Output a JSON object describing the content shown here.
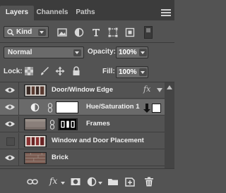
{
  "tabs": [
    {
      "label": "Layers",
      "active": true
    },
    {
      "label": "Channels",
      "active": false
    },
    {
      "label": "Paths",
      "active": false
    }
  ],
  "filter": {
    "kind_label": "Kind",
    "icons": [
      "image-filter-icon",
      "adjustment-filter-icon",
      "type-filter-icon",
      "shape-filter-icon",
      "smart-object-filter-icon"
    ]
  },
  "blend": {
    "mode": "Normal",
    "opacity_label": "Opacity:",
    "opacity_value": "100%"
  },
  "lock": {
    "label": "Lock:",
    "fill_label": "Fill:",
    "fill_value": "100%"
  },
  "layers": [
    {
      "name": "Door/Window Edge",
      "visible": true,
      "selected": false,
      "type": "pixel",
      "fx": "fx"
    },
    {
      "name": "Hue/Saturation 1",
      "visible": true,
      "selected": true,
      "type": "adjustment"
    },
    {
      "name": "Frames",
      "visible": true,
      "selected": false,
      "type": "pixel-mask"
    },
    {
      "name": "Window and Door Placement",
      "visible": false,
      "selected": false,
      "type": "pixel"
    },
    {
      "name": "Brick",
      "visible": true,
      "selected": false,
      "type": "pixel"
    }
  ],
  "bottom_icons": [
    "link-layers-icon",
    "add-style-icon",
    "add-mask-icon",
    "adjustment-layer-icon",
    "new-group-icon",
    "new-layer-icon",
    "delete-layer-icon"
  ],
  "bottom_fx_label": "fx",
  "colors": {
    "panel": "#535353",
    "selected": "#6a6a6a",
    "tabbar": "#3c3c3c"
  }
}
